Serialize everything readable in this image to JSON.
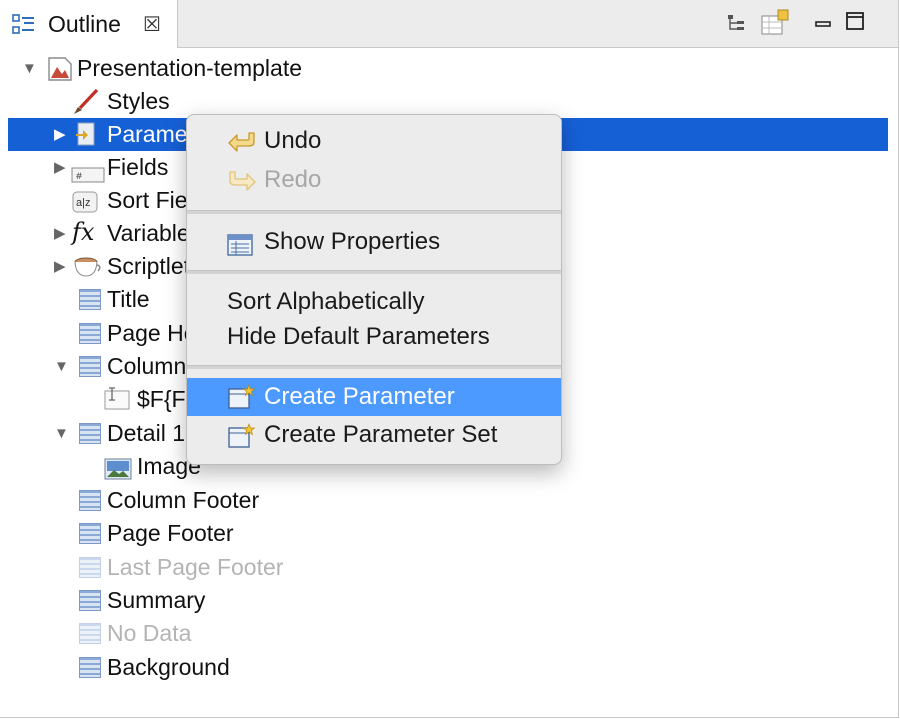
{
  "view": {
    "tab_title": "Outline",
    "tab_close_glyph": "☒",
    "toolbar_icons": [
      "tree-layout-icon",
      "filter-icon",
      "minimize-icon",
      "maximize-icon"
    ]
  },
  "tree": {
    "root": {
      "label": "Presentation-template",
      "icon": "report-icon",
      "expanded": true
    },
    "items": [
      {
        "label": "Styles",
        "icon": "brush-icon"
      },
      {
        "label": "Parameters",
        "icon": "parameter-icon",
        "expandable": true,
        "selected": true
      },
      {
        "label": "Fields",
        "icon": "field-icon",
        "expandable": true
      },
      {
        "label": "Sort Fields",
        "icon": "sort-icon"
      },
      {
        "label": "Variables",
        "icon": "fx-icon",
        "expandable": true
      },
      {
        "label": "Scriptlets",
        "icon": "cup-icon",
        "expandable": true
      },
      {
        "label": "Title",
        "icon": "band-icon"
      },
      {
        "label": "Page Header",
        "icon": "band-icon"
      },
      {
        "label": "Column Header",
        "icon": "band-icon",
        "expanded": true
      },
      {
        "label": "$F{Field}",
        "icon": "text-field-icon",
        "child": true
      },
      {
        "label": "Detail 1",
        "icon": "band-icon",
        "expanded": true
      },
      {
        "label": "Image",
        "icon": "image-icon",
        "child": true
      },
      {
        "label": "Column Footer",
        "icon": "band-icon"
      },
      {
        "label": "Page Footer",
        "icon": "band-icon"
      },
      {
        "label": "Last Page Footer",
        "icon": "band-icon",
        "disabled": true
      },
      {
        "label": "Summary",
        "icon": "band-icon"
      },
      {
        "label": "No Data",
        "icon": "band-icon",
        "disabled": true
      },
      {
        "label": "Background",
        "icon": "band-icon"
      }
    ]
  },
  "context_menu": {
    "undo": "Undo",
    "redo": "Redo",
    "show_properties": "Show Properties",
    "sort_alpha": "Sort Alphabetically",
    "hide_default": "Hide Default Parameters",
    "create_parameter": "Create Parameter",
    "create_parameter_set": "Create Parameter Set"
  },
  "colors": {
    "selection": "#1660d6",
    "menu_highlight": "#4c9aff",
    "menu_background": "#ececec"
  }
}
